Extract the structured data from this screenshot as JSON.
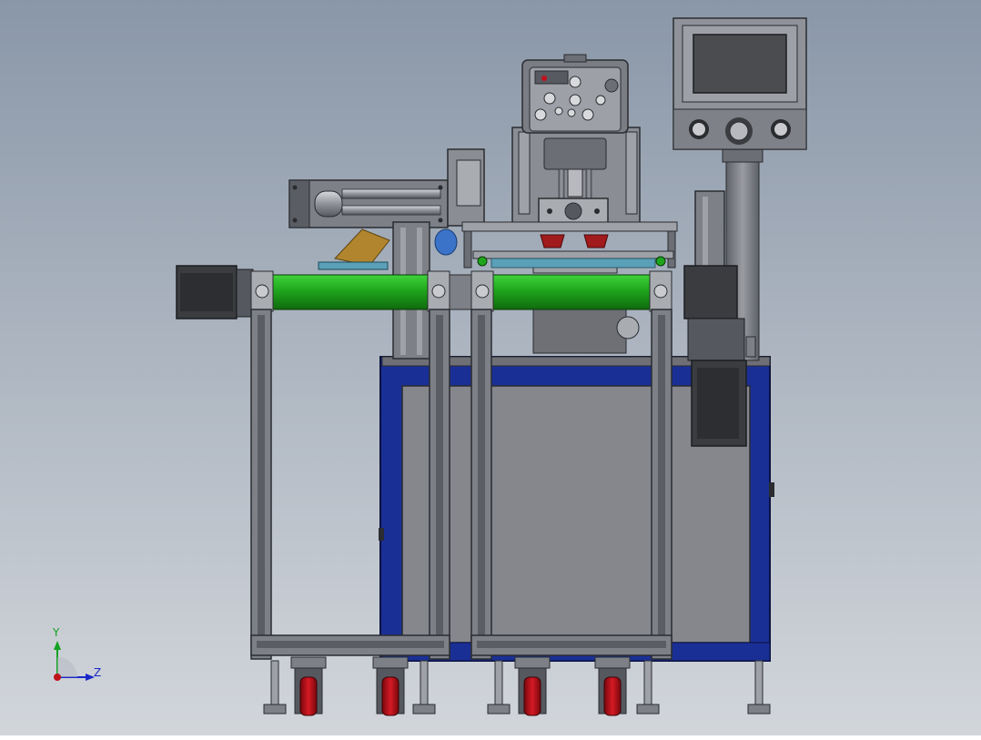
{
  "viewport": {
    "background_top": "#8a97a8",
    "background_bottom": "#d2d6db"
  },
  "colors": {
    "frame": "#7d8087",
    "frame_dark": "#3c3e44",
    "cabinet_blue": "#1a2f95",
    "cabinet_panel": "#85878c",
    "roller_green": "#1fa51c",
    "wheel_red": "#c3101c",
    "motor_dark": "#3a3c40",
    "screen": "#4a4c50",
    "wood": "#b0852e",
    "pipe_blue": "#3b73c8",
    "axis_x": "#c0121a",
    "axis_y": "#14a020",
    "axis_z": "#1928c8"
  },
  "triad": {
    "y_label": "Y",
    "z_label": "Z"
  },
  "parts": {
    "control_box": "control-box",
    "hmi_screen": "hmi-screen",
    "print_head": "pad-print-head",
    "left_motor": "left-drive-motor",
    "right_motor": "right-gear-motor",
    "rollers": "green-conveyor-rollers",
    "cabinet": "base-cabinet",
    "casters": "caster-wheels",
    "feet": "leveling-feet"
  }
}
